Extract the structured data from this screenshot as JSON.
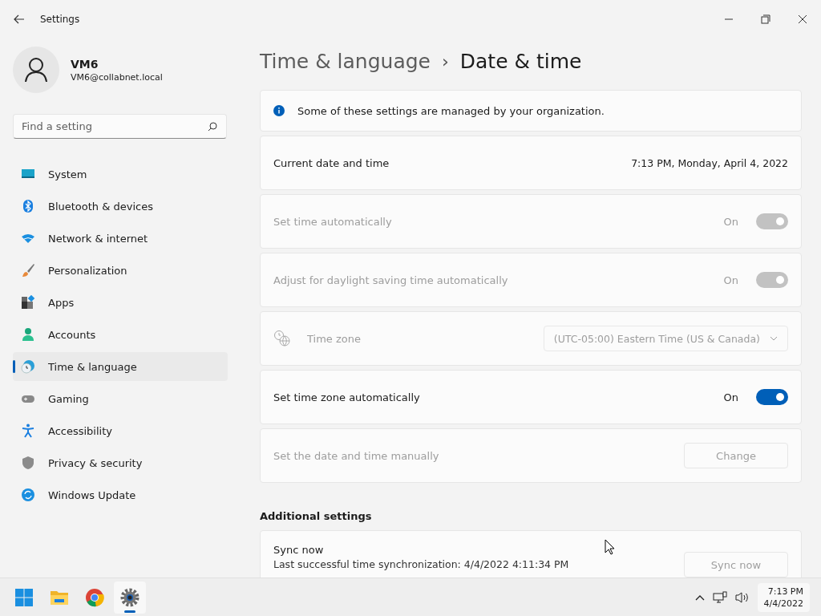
{
  "window": {
    "title": "Settings"
  },
  "user": {
    "name": "VM6",
    "email": "VM6@collabnet.local"
  },
  "search": {
    "placeholder": "Find a setting"
  },
  "nav": [
    {
      "label": "System",
      "kind": "system",
      "selected": false
    },
    {
      "label": "Bluetooth & devices",
      "kind": "bluetooth",
      "selected": false
    },
    {
      "label": "Network & internet",
      "kind": "network",
      "selected": false
    },
    {
      "label": "Personalization",
      "kind": "brush",
      "selected": false
    },
    {
      "label": "Apps",
      "kind": "apps",
      "selected": false
    },
    {
      "label": "Accounts",
      "kind": "accounts",
      "selected": false
    },
    {
      "label": "Time & language",
      "kind": "time",
      "selected": true
    },
    {
      "label": "Gaming",
      "kind": "gaming",
      "selected": false
    },
    {
      "label": "Accessibility",
      "kind": "accessibility",
      "selected": false
    },
    {
      "label": "Privacy & security",
      "kind": "privacy",
      "selected": false
    },
    {
      "label": "Windows Update",
      "kind": "update",
      "selected": false
    }
  ],
  "breadcrumb": {
    "parent": "Time & language",
    "separator": "›",
    "current": "Date & time"
  },
  "rows": [
    {
      "kind": "info",
      "text": "Some of these settings are managed by your organization."
    },
    {
      "kind": "value",
      "label": "Current date and time",
      "value": "7:13 PM, Monday, April 4, 2022",
      "disabled": false
    },
    {
      "kind": "toggle",
      "label": "Set time automatically",
      "state_text": "On",
      "on": true,
      "disabled": true
    },
    {
      "kind": "toggle",
      "label": "Adjust for daylight saving time automatically",
      "state_text": "On",
      "on": true,
      "disabled": true
    },
    {
      "kind": "dropdown",
      "label": "Time zone",
      "value": "(UTC-05:00) Eastern Time (US & Canada)",
      "disabled": true
    },
    {
      "kind": "toggle",
      "label": "Set time zone automatically",
      "state_text": "On",
      "on": true,
      "disabled": false
    },
    {
      "kind": "button",
      "label": "Set the date and time manually",
      "button": "Change",
      "disabled": true
    }
  ],
  "additional": {
    "title": "Additional settings",
    "sync_title": "Sync now",
    "sync_detail": "Last successful time synchronization: 4/4/2022 4:11:34 PM",
    "button": "Sync now",
    "disabled": true
  },
  "taskbar": {
    "apps": [
      {
        "kind": "start",
        "active": false
      },
      {
        "kind": "explorer",
        "active": false
      },
      {
        "kind": "chrome",
        "active": false
      },
      {
        "kind": "settings",
        "active": true
      }
    ],
    "time": "7:13 PM",
    "date": "4/4/2022"
  }
}
